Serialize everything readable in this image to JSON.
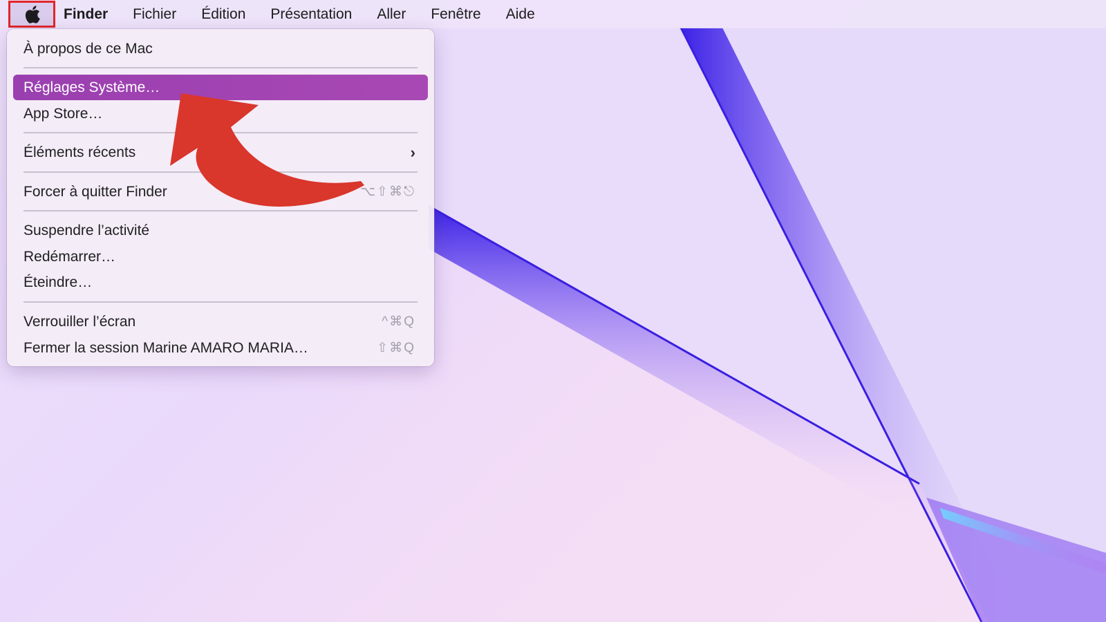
{
  "menubar": {
    "apple_icon": "apple-logo-icon",
    "items": [
      {
        "label": "Finder"
      },
      {
        "label": "Fichier"
      },
      {
        "label": "Édition"
      },
      {
        "label": "Présentation"
      },
      {
        "label": "Aller"
      },
      {
        "label": "Fenêtre"
      },
      {
        "label": "Aide"
      }
    ]
  },
  "apple_menu": {
    "items": [
      {
        "label": "À propos de ce Mac"
      },
      {
        "label": "Réglages Système…"
      },
      {
        "label": "App Store…"
      },
      {
        "label": "Éléments récents",
        "submenu_icon": "chevron-right-icon"
      },
      {
        "label": "Forcer à quitter Finder",
        "shortcut": "⌥⇧⌘⎋"
      },
      {
        "label": "Suspendre l’activité"
      },
      {
        "label": "Redémarrer…"
      },
      {
        "label": "Éteindre…"
      },
      {
        "label": "Verrouiller l’écran",
        "shortcut": "^⌘Q"
      },
      {
        "label": "Fermer la session Marine AMARO MARIA…",
        "shortcut": "⇧⌘Q"
      }
    ],
    "highlighted_item": "Réglages Système…"
  },
  "colors": {
    "highlight": "#9a3fb0",
    "annotation_box": "#e0262a",
    "annotation_arrow": "#d9362c",
    "wallpaper_accent": "#4a2ee8"
  },
  "annotation": {
    "arrow_icon": "curved-arrow-icon"
  }
}
